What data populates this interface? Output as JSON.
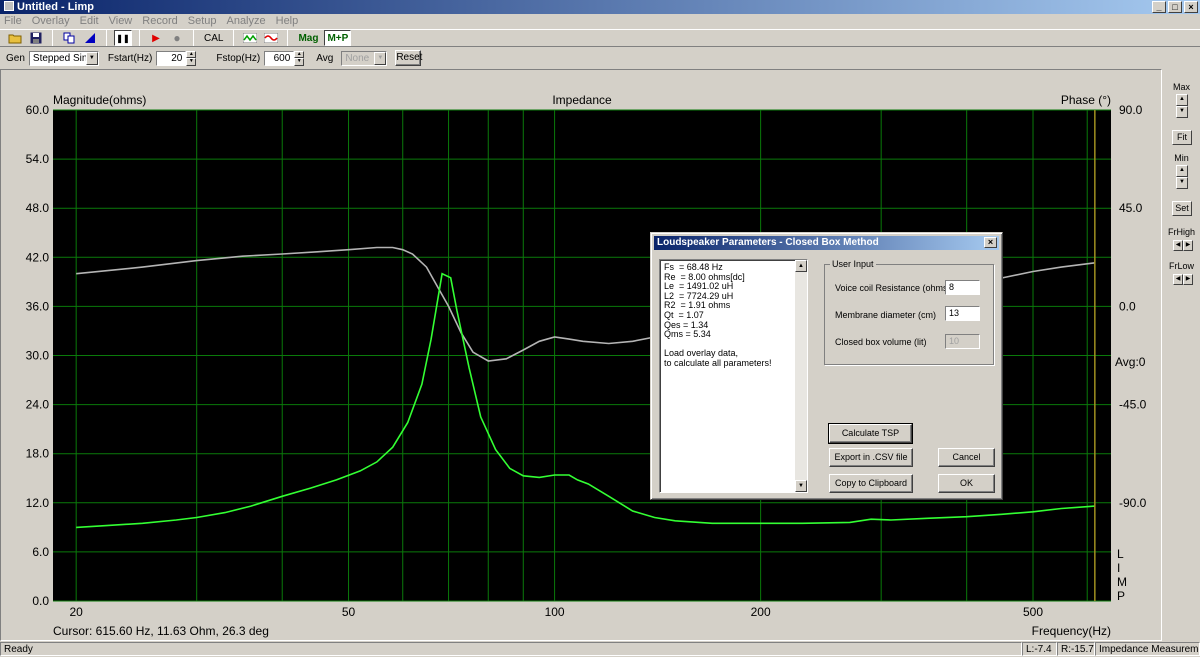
{
  "window": {
    "title": "Untitled - Limp",
    "minimize": "_",
    "maximize": "□",
    "close": "×"
  },
  "menu": [
    "File",
    "Overlay",
    "Edit",
    "View",
    "Record",
    "Setup",
    "Analyze",
    "Help"
  ],
  "toolbar": {
    "open_icon": "folder-icon",
    "save_icon": "disk-icon",
    "copy_icon": "copy-icon",
    "marker_icon": "marker-icon",
    "pause_label": "❚❚",
    "play_label": "▶",
    "record_label": "●",
    "cal_label": "CAL",
    "mag_label": "Mag",
    "mp_label": "M+P"
  },
  "controls": {
    "gen_label": "Gen",
    "gen_value": "Stepped Sine",
    "fstart_label": "Fstart(Hz)",
    "fstart_value": "20",
    "fstop_label": "Fstop(Hz)",
    "fstop_value": "600",
    "avg_label": "Avg",
    "avg_value": "None",
    "reset_label": "Reset"
  },
  "right_panel": {
    "max_label": "Max",
    "fit_label": "Fit",
    "min_label": "Min",
    "set_label": "Set",
    "frhigh_label": "FrHigh",
    "frlow_label": "FrLow"
  },
  "status": {
    "ready": "Ready",
    "left": "L:-7.4",
    "right": "R:-15.7",
    "mode": "Impedance Measurement"
  },
  "chart_data": {
    "type": "line",
    "title": "Impedance",
    "ylabel": "Magnitude(ohms)",
    "y2label": "Phase (°)",
    "xlabel": "Frequency(Hz)",
    "avg_label": "Avg:0",
    "vertical_brand": "LIMP",
    "cursor_text": "Cursor: 615.60 Hz, 11.63 Ohm, 26.3 deg",
    "xscale": "log",
    "xlim": [
      18.5,
      650
    ],
    "ylim": [
      0,
      60
    ],
    "y2lim": [
      -135,
      90
    ],
    "x_ticks": [
      20,
      50,
      100,
      200,
      500
    ],
    "y_ticks": [
      "0.0",
      "6.0",
      "12.0",
      "18.0",
      "24.0",
      "30.0",
      "36.0",
      "42.0",
      "48.0",
      "54.0",
      "60.0"
    ],
    "y2_ticks": [
      "90.0",
      "45.0",
      "0.0",
      "-45.0",
      "-90.0"
    ],
    "grid": true,
    "colors": {
      "background": "#000000",
      "grid": "#0a7a0a",
      "magnitude": "#33ff33",
      "phase": "#b4b4b4",
      "cursor": "#a09020"
    },
    "cursor_x": 615.6,
    "series": [
      {
        "name": "Magnitude",
        "x": [
          20,
          22,
          25,
          28,
          30,
          33,
          36,
          40,
          44,
          48,
          52,
          55,
          58,
          61,
          64,
          66,
          68.5,
          70.5,
          72,
          75,
          78,
          82,
          86,
          90,
          95,
          100,
          105,
          108,
          112,
          120,
          130,
          140,
          150,
          170,
          200,
          230,
          270,
          290,
          310,
          350,
          400,
          450,
          500,
          550,
          616
        ],
        "y": [
          9.0,
          9.2,
          9.5,
          9.9,
          10.2,
          10.8,
          11.6,
          12.8,
          13.8,
          14.8,
          15.9,
          17.0,
          18.8,
          21.8,
          26.5,
          32.0,
          40.0,
          39.5,
          35.5,
          28.5,
          22.5,
          18.5,
          16.2,
          15.3,
          15.1,
          15.4,
          15.4,
          14.8,
          14.3,
          12.8,
          11.0,
          10.2,
          9.8,
          9.5,
          9.5,
          9.5,
          9.6,
          10.0,
          9.9,
          10.1,
          10.3,
          10.6,
          10.9,
          11.3,
          11.6
        ]
      },
      {
        "name": "Phase",
        "x": [
          20,
          25,
          30,
          35,
          40,
          45,
          50,
          55,
          58,
          60,
          62,
          65,
          68,
          70,
          73,
          76,
          80,
          85,
          90,
          95,
          100,
          105,
          110,
          120,
          130,
          140,
          150,
          170,
          200,
          250,
          300,
          350,
          400,
          450,
          500,
          550,
          616
        ],
        "y": [
          15,
          18,
          21,
          23,
          24,
          25,
          26,
          27,
          27,
          26,
          24,
          18,
          7,
          0,
          -12,
          -21,
          -25,
          -24,
          -20,
          -16,
          -14,
          -15,
          -16,
          -17,
          -16,
          -14,
          -12,
          -8,
          -3,
          3,
          5,
          7,
          10,
          13,
          16,
          18,
          20
        ]
      }
    ]
  },
  "dialog": {
    "title": "Loudspeaker Parameters - Closed Box Method",
    "close": "×",
    "results": [
      "Fs  = 68.48 Hz",
      "Re  = 8.00 ohms[dc]",
      "Le  = 1491.02 uH",
      "L2  = 7724.29 uH",
      "R2  = 1.91 ohms",
      "Qt  = 1.07",
      "Qes = 1.34",
      "Qms = 5.34",
      "",
      "Load overlay data,",
      "to calculate all parameters!"
    ],
    "group_title": "User Input",
    "voice_coil_label": "Voice coil Resistance (ohms)",
    "voice_coil_value": "8",
    "membrane_label": "Membrane diameter (cm)",
    "membrane_value": "13",
    "box_volume_label": "Closed box volume (lit)",
    "box_volume_value": "10",
    "calculate_label": "Calculate TSP",
    "export_label": "Export in .CSV file",
    "clipboard_label": "Copy to Clipboard",
    "cancel_label": "Cancel",
    "ok_label": "OK"
  }
}
